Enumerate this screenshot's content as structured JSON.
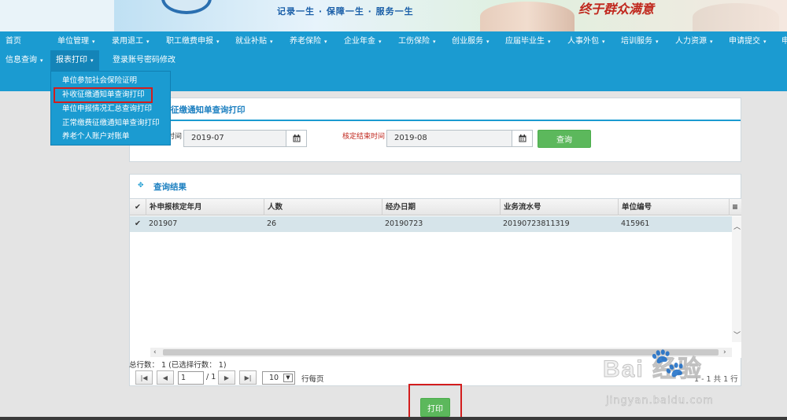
{
  "banner": {
    "slogan": "记录一生 · 保障一生 · 服务一生",
    "motto": "终于群众满意"
  },
  "nav": {
    "row1": [
      {
        "label": "首页",
        "caret": ""
      },
      {
        "label": "单位管理",
        "caret": "▾"
      },
      {
        "label": "录用退工",
        "caret": "▾"
      },
      {
        "label": "职工缴费申报",
        "caret": "▾"
      },
      {
        "label": "就业补贴",
        "caret": "▾"
      },
      {
        "label": "养老保险",
        "caret": "▾"
      },
      {
        "label": "企业年金",
        "caret": "▾"
      },
      {
        "label": "工伤保险",
        "caret": "▾"
      },
      {
        "label": "创业服务",
        "caret": "▾"
      },
      {
        "label": "应届毕业生",
        "caret": "▾"
      },
      {
        "label": "人事外包",
        "caret": "▾"
      },
      {
        "label": "培训服务",
        "caret": "▾"
      },
      {
        "label": "人力资源",
        "caret": "▾"
      },
      {
        "label": "申请提交",
        "caret": "▾"
      },
      {
        "label": "申",
        "caret": ""
      }
    ],
    "row2": [
      {
        "label": "信息查询",
        "caret": "▾"
      },
      {
        "label": "报表打印",
        "caret": "▾"
      },
      {
        "label": "登录账号密码修改",
        "caret": ""
      }
    ]
  },
  "dropdown": {
    "items": [
      "单位参加社会保险证明",
      "补收征缴通知单查询打印",
      "单位申报情况汇总查询打印",
      "正常缴费征缴通知单查询打印",
      "养老个人账户对账单"
    ]
  },
  "query": {
    "title": "征缴通知单查询打印",
    "start_label": "时间",
    "end_label": "核定结束时间",
    "start_value": "2019-07",
    "end_value": "2019-08",
    "button": "查询"
  },
  "results": {
    "title": "查询结果",
    "columns": [
      "补申报核定年月",
      "人数",
      "经办日期",
      "业务流水号",
      "单位编号"
    ],
    "rows": [
      [
        "201907",
        "26",
        "20190723",
        "20190723811319",
        "415961"
      ]
    ],
    "total_info": "总行数： 1 (已选择行数： 1)",
    "page_value": "1",
    "page_total": "/ 1",
    "per_page_value": "10",
    "per_page_label": "行每页",
    "range_info": "1 - 1 共 1 行"
  },
  "print_button": "打印",
  "watermark": {
    "brand": "Bai 经验",
    "url": "jingyan.baidu.com"
  }
}
